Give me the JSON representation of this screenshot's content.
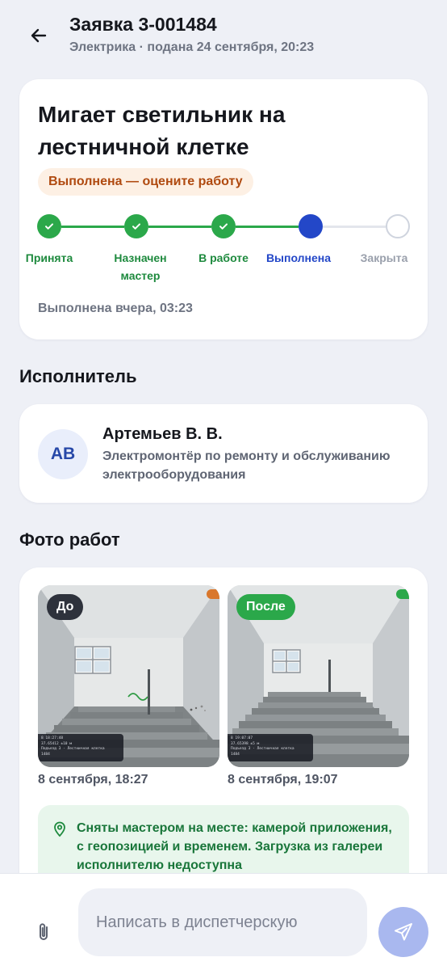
{
  "header": {
    "title": "Заявка 3-001484",
    "subtitle": "Электрика · подана 24 сентября, 20:23"
  },
  "request": {
    "title": "Мигает светильник на лестничной клетке",
    "status_badge": "Выполнена — оцените работу",
    "completed_text": "Выполнена вчера, 03:23",
    "steps": [
      {
        "label": "Принята",
        "state": "done"
      },
      {
        "label": "Назначен мастер",
        "state": "done"
      },
      {
        "label": "В работе",
        "state": "done"
      },
      {
        "label": "Выполнена",
        "state": "current"
      },
      {
        "label": "Закрыта",
        "state": "pending"
      }
    ]
  },
  "executor": {
    "section_title": "Исполнитель",
    "initials": "АВ",
    "name": "Артемьев В. В.",
    "role": "Электромонтёр по ремонту и обслуживанию электрооборудования"
  },
  "photos": {
    "section_title": "Фото работ",
    "before": {
      "tag": "До",
      "caption": "8 сентября, 18:27",
      "stamp": "8 18:27:48\n37.65412 ±10 м\nПодъезд 3 · Лестничная клетка\n1484"
    },
    "after": {
      "tag": "После",
      "caption": "8 сентября, 19:07",
      "stamp": "8 19:07:07\n37.65398 ±5 м\nПодъезд 3 · Лестничная клетка\n1484"
    },
    "geo_note": "Сняты мастером на месте: камерой приложения, с геопозицией и временем. Загрузка из галереи исполнителю недоступна"
  },
  "composer": {
    "placeholder": "Написать в диспетчерскую"
  },
  "colors": {
    "done": "#2ba84a",
    "current": "#2347c8",
    "pending": "#cfd4de",
    "badge_bg": "#fdf0e4",
    "badge_text": "#b04a10",
    "send": "#a9b8ef"
  },
  "icons": {
    "back": "arrow-left-icon",
    "check": "check-icon",
    "pin": "map-pin-icon",
    "attach": "paperclip-icon",
    "send": "send-icon"
  }
}
